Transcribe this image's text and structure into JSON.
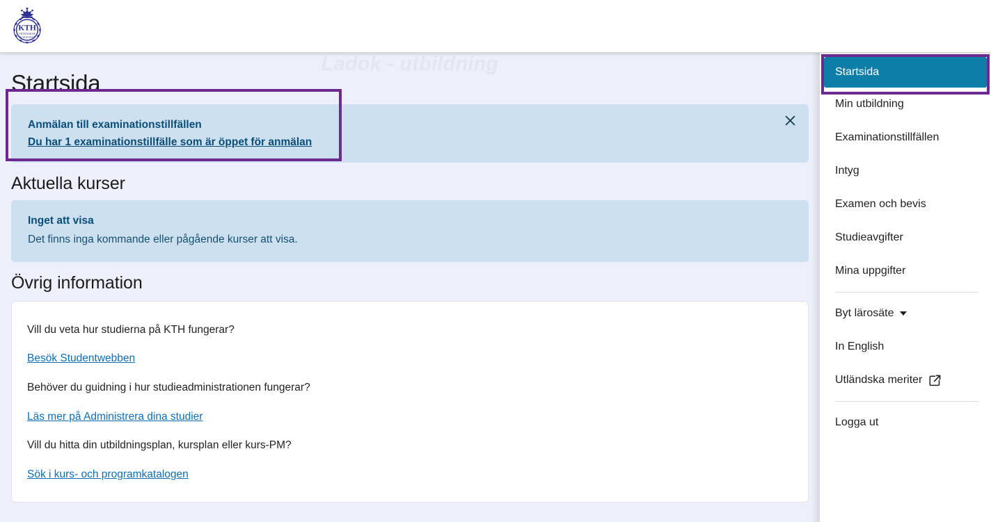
{
  "header": {
    "logo_name": "kth-logo",
    "logo_text": "KTH",
    "logo_motto_line1": "VETENSKAP",
    "logo_motto_line2": "OCH KONST"
  },
  "watermark": {
    "text": "Ladok - utbildning"
  },
  "main": {
    "page_title": "Startsida",
    "notification": {
      "title": "Anmälan till examinationstillfällen",
      "link": "Du har 1 examinationstillfälle som är öppet för anmälan",
      "close_icon": "close-icon",
      "close_glyph": "✕"
    },
    "current_courses": {
      "heading": "Aktuella kurser",
      "title": "Inget att visa",
      "text": "Det finns inga kommande eller pågående kurser att visa."
    },
    "other_info": {
      "heading": "Övrig information",
      "rows": [
        {
          "question": "Vill du veta hur studierna på KTH fungerar?",
          "link": "Besök Studentwebben"
        },
        {
          "question": "Behöver du guidning i hur studieadministrationen fungerar?",
          "link": "Läs mer på Administrera dina studier"
        },
        {
          "question": "Vill du hitta din utbildningsplan, kursplan eller kurs-PM?",
          "link": "Sök i kurs- och programkatalogen"
        }
      ]
    }
  },
  "sidebar": {
    "items": [
      {
        "label": "Startsida",
        "active": true,
        "icon": null
      },
      {
        "label": "Min utbildning",
        "active": false,
        "icon": null
      },
      {
        "label": "Examinationstillfällen",
        "active": false,
        "icon": null
      },
      {
        "label": "Intyg",
        "active": false,
        "icon": null
      },
      {
        "label": "Examen och bevis",
        "active": false,
        "icon": null
      },
      {
        "label": "Studieavgifter",
        "active": false,
        "icon": null
      },
      {
        "label": "Mina uppgifter",
        "active": false,
        "icon": null
      },
      {
        "label": "Byt lärosäte",
        "active": false,
        "icon": "chevron-down-icon"
      },
      {
        "label": "In English",
        "active": false,
        "icon": null
      },
      {
        "label": "Utländska meriter",
        "active": false,
        "icon": "external-link-icon"
      },
      {
        "label": "Logga ut",
        "active": false,
        "icon": null
      }
    ]
  },
  "colors": {
    "accent_teal": "#0d7ea8",
    "annotation_purple": "#6d2a8e",
    "alert_blue_bg": "#cde0f0",
    "alert_text": "#0a4d77",
    "link_blue": "#0d6db5",
    "page_bg": "#edf0fa",
    "watermark_gray": "#e2e6f3"
  }
}
